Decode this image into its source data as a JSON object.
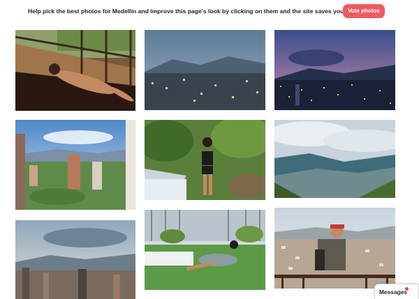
{
  "banner": {
    "text": "Help pick the best photos for Medellín and improve this page's look by clicking on them and the site saves your feedback",
    "vote_label": "Vote photos",
    "accent_color": "#f05a5f"
  },
  "photos": [
    {
      "name": "photo-woman-balcony",
      "subject": "woman lying on a balcony"
    },
    {
      "name": "photo-city-dusk",
      "subject": "Medellín cityscape at dusk"
    },
    {
      "name": "photo-city-night",
      "subject": "Medellín city lights at night"
    },
    {
      "name": "photo-city-towers",
      "subject": "Medellín high-rise towers"
    },
    {
      "name": "photo-woman-waterfall",
      "subject": "woman by a waterfall"
    },
    {
      "name": "photo-valley-clouds",
      "subject": "Medellín valley under clouds"
    },
    {
      "name": "photo-city-skyline",
      "subject": "Medellín skyline"
    },
    {
      "name": "photo-woman-lawn",
      "subject": "woman posing on a lawn"
    },
    {
      "name": "photo-man-overlook",
      "subject": "man at a city overlook"
    }
  ],
  "messages": {
    "label": "Messages",
    "dot_color": "#e8434b"
  }
}
